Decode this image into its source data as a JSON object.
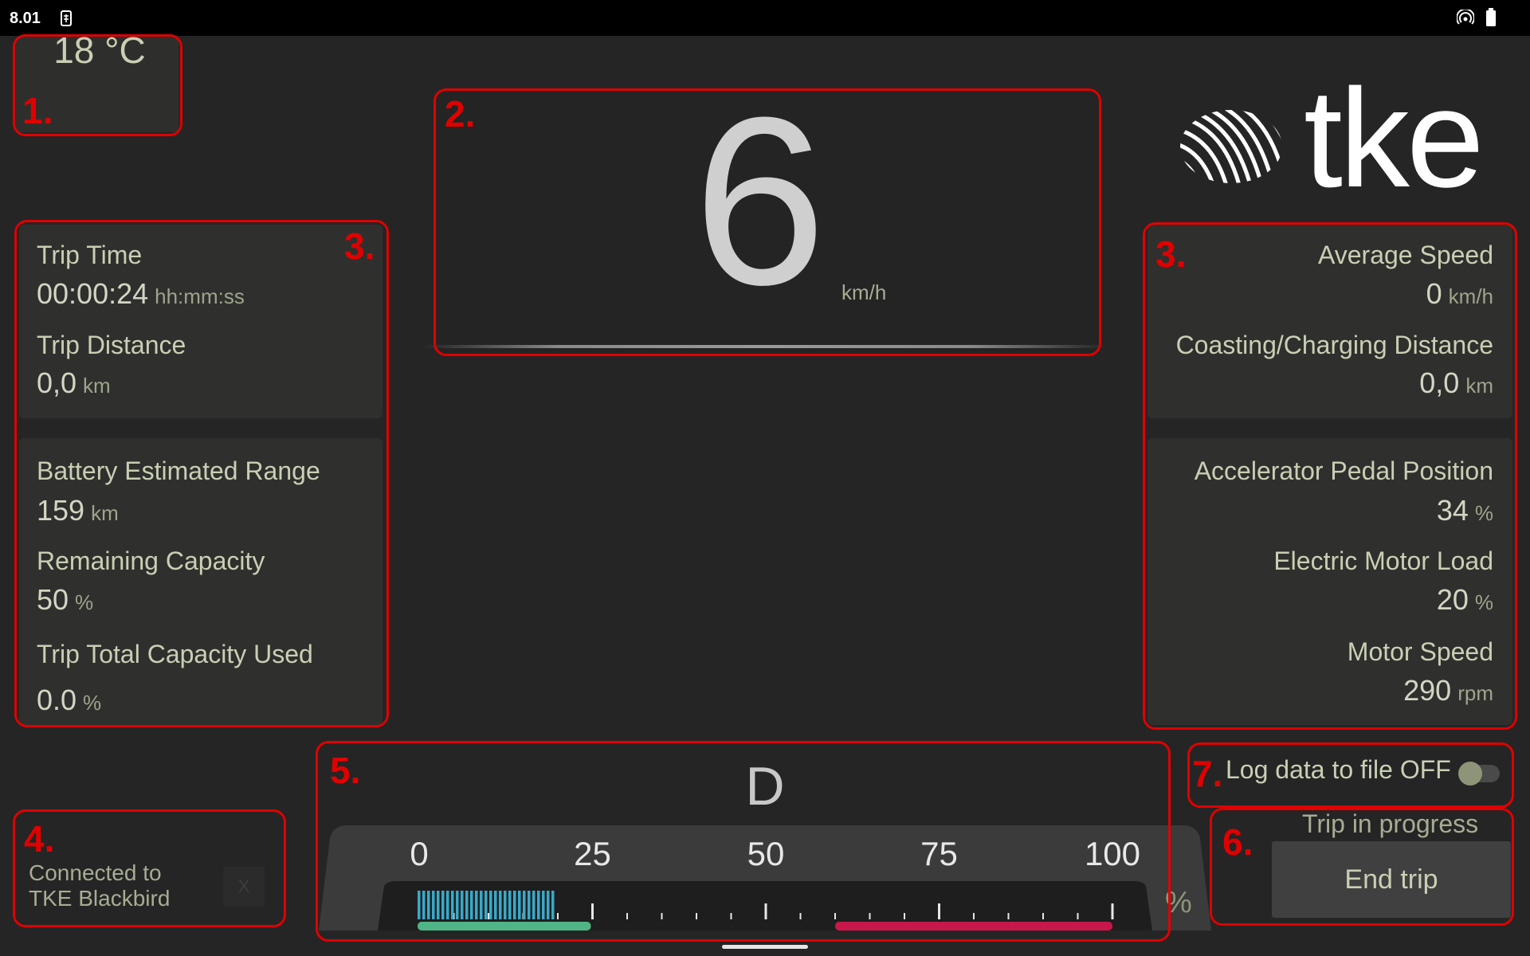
{
  "status_bar": {
    "time": "8.01"
  },
  "temperature": {
    "value": "18 °C"
  },
  "speed": {
    "value": "6",
    "unit": "km/h"
  },
  "brand": {
    "logo_text": "tke"
  },
  "trip_panel": {
    "trip_time_label": "Trip Time",
    "trip_time_value": "00:00:24",
    "trip_time_unit": "hh:mm:ss",
    "trip_distance_label": "Trip Distance",
    "trip_distance_value": "0,0",
    "trip_distance_unit": "km"
  },
  "battery_panel": {
    "range_label": "Battery Estimated Range",
    "range_value": "159",
    "range_unit": "km",
    "capacity_label": "Remaining Capacity",
    "capacity_value": "50",
    "capacity_unit": "%",
    "used_label": "Trip Total Capacity Used",
    "used_value": "0.0",
    "used_unit": "%"
  },
  "speed_panel": {
    "avg_label": "Average Speed",
    "avg_value": "0",
    "avg_unit": "km/h",
    "coast_label": "Coasting/Charging Distance",
    "coast_value": "0,0",
    "coast_unit": "km"
  },
  "motor_panel": {
    "pedal_label": "Accelerator Pedal Position",
    "pedal_value": "34",
    "pedal_unit": "%",
    "load_label": "Electric Motor Load",
    "load_value": "20",
    "load_unit": "%",
    "rpm_label": "Motor Speed",
    "rpm_value": "290",
    "rpm_unit": "rpm"
  },
  "connection": {
    "line1": "Connected to",
    "line2": "TKE Blackbird",
    "close_label": "X"
  },
  "gear": {
    "value": "D"
  },
  "gauge": {
    "ticks": [
      "0",
      "25",
      "50",
      "75",
      "100"
    ],
    "unit": "%",
    "level_percent": 20,
    "colors": {
      "level": "#39a9c9",
      "green_zone": "#4fb486",
      "red_zone": "#c8174b"
    }
  },
  "log_toggle": {
    "label": "Log data to file OFF",
    "state": "off"
  },
  "trip_control": {
    "status": "Trip in progress",
    "button_label": "End trip"
  },
  "annotations": [
    "1.",
    "2.",
    "3.",
    "3.",
    "4.",
    "5.",
    "6.",
    "7."
  ]
}
